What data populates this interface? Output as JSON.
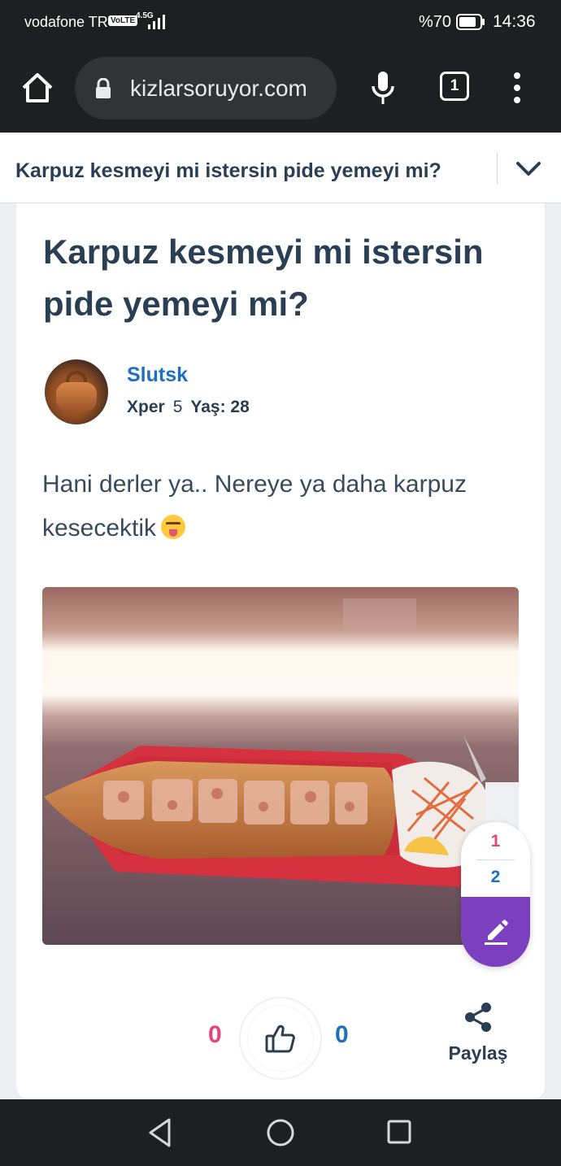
{
  "status_bar": {
    "carrier": "vodafone TR",
    "volte": "VoLTE",
    "network": "4.5G",
    "battery_percent": "%70",
    "time": "14:36"
  },
  "browser": {
    "url": "kizlarsoruyor.com",
    "tab_count": "1"
  },
  "sticky_header": {
    "title": "Karpuz kesmeyi mi istersin pide yemeyi mi?"
  },
  "question": {
    "title": "Karpuz kesmeyi mi istersin pide yemeyi mi?",
    "author": {
      "name": "Slutsk",
      "badge": "Xper",
      "level": "5",
      "age_label": "Yaş: 28"
    },
    "body": "Hani derler ya.. Nereye ya daha karpuz kesecektik",
    "emoji_icon": "squinting-face-with-tongue-icon"
  },
  "pager": {
    "page1": "1",
    "page2": "2"
  },
  "actions": {
    "dislike_count": "0",
    "like_count": "0",
    "share_label": "Paylaş"
  },
  "colors": {
    "accent_blue": "#1e6fc0",
    "accent_pink": "#e5457e",
    "accent_purple": "#7b3fbf",
    "title_navy": "#2a3f54"
  }
}
